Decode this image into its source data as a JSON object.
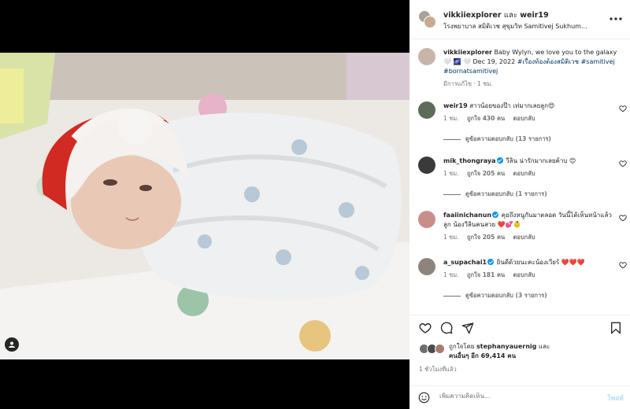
{
  "post": {
    "author1": "vikkiiexplorer",
    "joiner": "และ",
    "author2": "weir19",
    "location": "โรงพยาบาล สมิติเวช สุขุมวิท Samitivej Sukhum...",
    "more_icon": "more-horizontal-icon"
  },
  "caption": {
    "user": "vikkiiexplorer",
    "text": "Baby Wylyn, we love you to the galaxy 🤍 🌌 🤍 Dec 19, 2022",
    "tags": "#เรื่องท้องต้องสมิติเวช #samitivej #bornatsamitivej",
    "meta": "มีการแก้ไข · 1 ชม."
  },
  "comments": [
    {
      "user": "weir19",
      "verified": false,
      "text": "สาวน้อยของป๊า เท่มากเลยลูก😍",
      "time": "1 ชม.",
      "likes": "ถูกใจ 430 คน",
      "reply": "ตอบกลับ",
      "replies": "ดูข้อความตอบกลับ (13 รายการ)",
      "avatar_color": "#5d6b5a"
    },
    {
      "user": "mik_thongraya",
      "verified": true,
      "text": "วีลิน น่ารักมากเลยค้าบ 😊",
      "time": "1 ชม.",
      "likes": "ถูกใจ 205 คน",
      "reply": "ตอบกลับ",
      "replies": "ดูข้อความตอบกลับ (1 รายการ)",
      "avatar_color": "#3a3a3a"
    },
    {
      "user": "faaiinichanun",
      "verified": true,
      "text": "คุยถึงหนูกันมาตลอด วันนี้ได้เห็นหน้าแล้วลูก น้องวีลินคนสวย ❤️💕👶",
      "time": "1 ชม.",
      "likes": "ถูกใจ 205 คน",
      "reply": "ตอบกลับ",
      "replies": "",
      "avatar_color": "#c98e8a"
    },
    {
      "user": "a_supachai1",
      "verified": true,
      "text": "ยินดีด้วยนะคะน้องเวียร์ ❤️❤️❤️",
      "time": "1 ชม.",
      "likes": "ถูกใจ 181 คน",
      "reply": "ตอบกลับ",
      "replies": "ดูข้อความตอบกลับ (3 รายการ)",
      "avatar_color": "#8d857d"
    }
  ],
  "likes": {
    "prefix": "ถูกใจโดย",
    "user": "stephanyauernig",
    "and": "และ",
    "others": "คนอื่นๆ อีก 69,414 คน"
  },
  "time_ago": "1 ชั่วโมงที่แล้ว",
  "comment_box": {
    "placeholder": "เพิ่มความคิดเห็น...",
    "post": "โพสต์"
  },
  "icons": [
    "heart-icon",
    "comment-icon",
    "share-icon",
    "bookmark-icon",
    "emoji-icon",
    "tag-user-icon"
  ],
  "colors": {
    "link": "#00376b",
    "verified": "#0095f6",
    "post_disabled": "#b2dffc",
    "heart_red": "#ed4956"
  }
}
